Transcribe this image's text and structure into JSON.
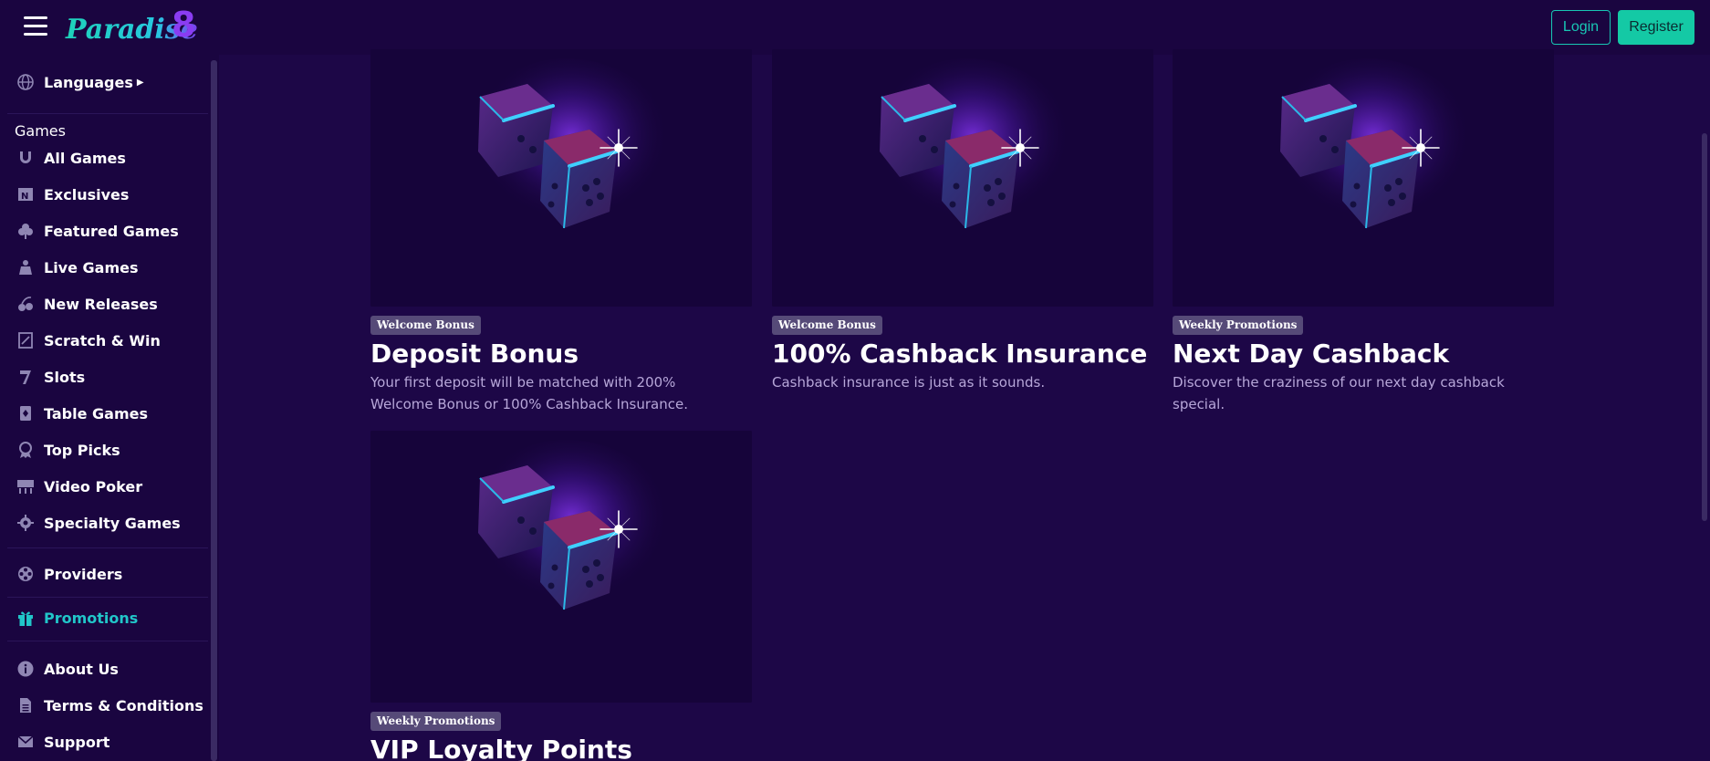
{
  "header": {
    "logo_text": "Paradise 8",
    "login_label": "Login",
    "register_label": "Register"
  },
  "sidebar": {
    "languages_label": "Languages",
    "games_section_label": "Games",
    "games": [
      {
        "label": "All Games",
        "icon": "horseshoe-icon"
      },
      {
        "label": "Exclusives",
        "icon": "exclusive-badge-icon"
      },
      {
        "label": "Featured Games",
        "icon": "clover-icon"
      },
      {
        "label": "Live Games",
        "icon": "dealer-icon"
      },
      {
        "label": "New Releases",
        "icon": "cherries-icon"
      },
      {
        "label": "Scratch & Win",
        "icon": "scratch-card-icon"
      },
      {
        "label": "Slots",
        "icon": "seven-icon"
      },
      {
        "label": "Table Games",
        "icon": "playing-card-icon"
      },
      {
        "label": "Top Picks",
        "icon": "award-icon"
      },
      {
        "label": "Video Poker",
        "icon": "poker-machine-icon"
      },
      {
        "label": "Specialty Games",
        "icon": "gear-icon"
      }
    ],
    "providers_label": "Providers",
    "promotions_label": "Promotions",
    "about_label": "About Us",
    "terms_label": "Terms & Conditions",
    "support_label": "Support"
  },
  "promotions": [
    {
      "badge": "Welcome Bonus",
      "title": "Deposit Bonus",
      "description": "Your first deposit will be matched with 200% Welcome Bonus or 100% Cashback Insurance."
    },
    {
      "badge": "Welcome Bonus",
      "title": "100% Cashback Insurance",
      "description": "Cashback insurance is just as it sounds."
    },
    {
      "badge": "Weekly Promotions",
      "title": "Next Day Cashback",
      "description": "Discover the craziness of our next day cashback special."
    },
    {
      "badge": "Weekly Promotions",
      "title": "VIP Loyalty Points",
      "description": ""
    }
  ],
  "colors": {
    "background": "#1d0747",
    "accent": "#14c9a5",
    "active_nav": "#21c6c9",
    "badge": "#564a78"
  }
}
